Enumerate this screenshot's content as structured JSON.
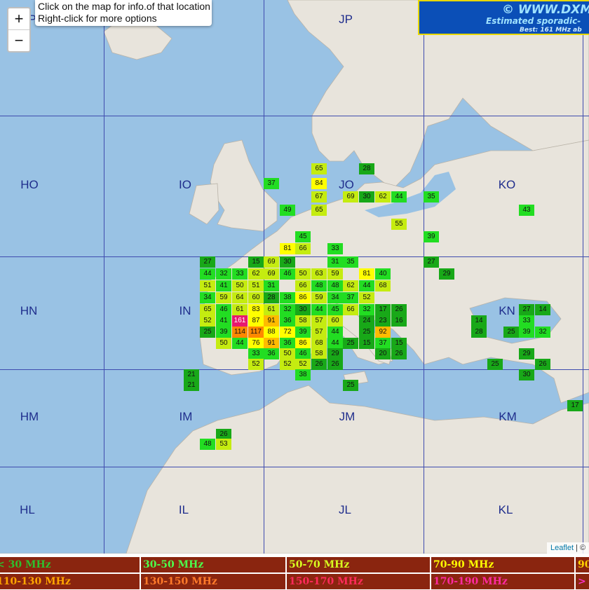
{
  "info_box": {
    "line1": "Click on the map for info.of that location",
    "line2": "Right-click for more options"
  },
  "zoom": {
    "in_label": "+",
    "out_label": "−"
  },
  "banner": {
    "line1": "© WWW.DXMA",
    "line2": "Estimated sporadic-",
    "line3": "Best: 161 MHz ab"
  },
  "attribution": {
    "link": "Leaflet",
    "rest": " | © "
  },
  "grid_labels": [
    "P",
    "JP",
    "HO",
    "IO",
    "JO",
    "KO",
    "HN",
    "IN",
    "JN",
    "KN",
    "HM",
    "IM",
    "JM",
    "KM",
    "HL",
    "IL",
    "JL",
    "KL"
  ],
  "cells": [
    {
      "v": "65",
      "c": "#c5ec10"
    },
    {
      "v": "28",
      "c": "#18a818"
    },
    {
      "v": "37",
      "c": "#22dd22"
    },
    {
      "v": "84",
      "c": "#ffff00"
    },
    {
      "v": "67",
      "c": "#c5ec10"
    },
    {
      "v": "69",
      "c": "#c5ec10"
    },
    {
      "v": "30",
      "c": "#18a818"
    },
    {
      "v": "62",
      "c": "#c5ec10"
    },
    {
      "v": "44",
      "c": "#22dd22"
    },
    {
      "v": "35",
      "c": "#22dd22"
    },
    {
      "v": "49",
      "c": "#22dd22"
    },
    {
      "v": "65",
      "c": "#c5ec10"
    },
    {
      "v": "43",
      "c": "#22dd22"
    },
    {
      "v": "55",
      "c": "#c5ec10"
    },
    {
      "v": "45",
      "c": "#22dd22"
    },
    {
      "v": "39",
      "c": "#22dd22"
    },
    {
      "v": "81",
      "c": "#ffff00"
    },
    {
      "v": "66",
      "c": "#c5ec10"
    },
    {
      "v": "33",
      "c": "#22dd22"
    },
    {
      "v": "27",
      "c": "#18a818"
    },
    {
      "v": "15",
      "c": "#18a818"
    },
    {
      "v": "69",
      "c": "#c5ec10"
    },
    {
      "v": "30",
      "c": "#18a818"
    },
    {
      "v": "31",
      "c": "#22dd22"
    },
    {
      "v": "35",
      "c": "#22dd22"
    },
    {
      "v": "27",
      "c": "#18a818"
    },
    {
      "v": "44",
      "c": "#22dd22"
    },
    {
      "v": "32",
      "c": "#22dd22"
    },
    {
      "v": "33",
      "c": "#22dd22"
    },
    {
      "v": "62",
      "c": "#c5ec10"
    },
    {
      "v": "69",
      "c": "#c5ec10"
    },
    {
      "v": "46",
      "c": "#22dd22"
    },
    {
      "v": "50",
      "c": "#c5ec10"
    },
    {
      "v": "63",
      "c": "#c5ec10"
    },
    {
      "v": "59",
      "c": "#c5ec10"
    },
    {
      "v": "81",
      "c": "#ffff00"
    },
    {
      "v": "40",
      "c": "#22dd22"
    },
    {
      "v": "29",
      "c": "#18a818"
    },
    {
      "v": "51",
      "c": "#c5ec10"
    },
    {
      "v": "41",
      "c": "#22dd22"
    },
    {
      "v": "50",
      "c": "#c5ec10"
    },
    {
      "v": "51",
      "c": "#c5ec10"
    },
    {
      "v": "31",
      "c": "#22dd22"
    },
    {
      "v": "66",
      "c": "#c5ec10"
    },
    {
      "v": "48",
      "c": "#22dd22"
    },
    {
      "v": "48",
      "c": "#22dd22"
    },
    {
      "v": "62",
      "c": "#c5ec10"
    },
    {
      "v": "44",
      "c": "#22dd22"
    },
    {
      "v": "68",
      "c": "#c5ec10"
    },
    {
      "v": "34",
      "c": "#22dd22"
    },
    {
      "v": "59",
      "c": "#c5ec10"
    },
    {
      "v": "64",
      "c": "#c5ec10"
    },
    {
      "v": "60",
      "c": "#c5ec10"
    },
    {
      "v": "28",
      "c": "#18a818"
    },
    {
      "v": "38",
      "c": "#22dd22"
    },
    {
      "v": "86",
      "c": "#ffff00"
    },
    {
      "v": "59",
      "c": "#c5ec10"
    },
    {
      "v": "34",
      "c": "#22dd22"
    },
    {
      "v": "37",
      "c": "#22dd22"
    },
    {
      "v": "52",
      "c": "#c5ec10"
    },
    {
      "v": "65",
      "c": "#c5ec10"
    },
    {
      "v": "46",
      "c": "#22dd22"
    },
    {
      "v": "61",
      "c": "#c5ec10"
    },
    {
      "v": "83",
      "c": "#ffff00"
    },
    {
      "v": "61",
      "c": "#c5ec10"
    },
    {
      "v": "32",
      "c": "#22dd22"
    },
    {
      "v": "30",
      "c": "#18a818"
    },
    {
      "v": "44",
      "c": "#22dd22"
    },
    {
      "v": "45",
      "c": "#22dd22"
    },
    {
      "v": "66",
      "c": "#c5ec10"
    },
    {
      "v": "32",
      "c": "#22dd22"
    },
    {
      "v": "17",
      "c": "#18a818"
    },
    {
      "v": "26",
      "c": "#18a818"
    },
    {
      "v": "27",
      "c": "#18a818"
    },
    {
      "v": "14",
      "c": "#18a818"
    },
    {
      "v": "52",
      "c": "#c5ec10"
    },
    {
      "v": "41",
      "c": "#22dd22"
    },
    {
      "v": "161",
      "c": "#e8186e"
    },
    {
      "v": "87",
      "c": "#ffff00"
    },
    {
      "v": "91",
      "c": "#ffbb00"
    },
    {
      "v": "36",
      "c": "#22dd22"
    },
    {
      "v": "58",
      "c": "#c5ec10"
    },
    {
      "v": "57",
      "c": "#c5ec10"
    },
    {
      "v": "60",
      "c": "#c5ec10"
    },
    {
      "v": "24",
      "c": "#18a818"
    },
    {
      "v": "23",
      "c": "#18a818"
    },
    {
      "v": "16",
      "c": "#18a818"
    },
    {
      "v": "14",
      "c": "#18a818"
    },
    {
      "v": "33",
      "c": "#22dd22"
    },
    {
      "v": "25",
      "c": "#18a818"
    },
    {
      "v": "39",
      "c": "#22dd22"
    },
    {
      "v": "114",
      "c": "#ff8800"
    },
    {
      "v": "117",
      "c": "#ff8800"
    },
    {
      "v": "88",
      "c": "#ffff00"
    },
    {
      "v": "72",
      "c": "#ffff00"
    },
    {
      "v": "39",
      "c": "#22dd22"
    },
    {
      "v": "57",
      "c": "#c5ec10"
    },
    {
      "v": "44",
      "c": "#22dd22"
    },
    {
      "v": "25",
      "c": "#18a818"
    },
    {
      "v": "92",
      "c": "#ffbb00"
    },
    {
      "v": "28",
      "c": "#18a818"
    },
    {
      "v": "25",
      "c": "#18a818"
    },
    {
      "v": "39",
      "c": "#22dd22"
    },
    {
      "v": "32",
      "c": "#22dd22"
    },
    {
      "v": "50",
      "c": "#c5ec10"
    },
    {
      "v": "44",
      "c": "#22dd22"
    },
    {
      "v": "76",
      "c": "#ffff00"
    },
    {
      "v": "91",
      "c": "#ffbb00"
    },
    {
      "v": "36",
      "c": "#22dd22"
    },
    {
      "v": "86",
      "c": "#ffff00"
    },
    {
      "v": "68",
      "c": "#c5ec10"
    },
    {
      "v": "44",
      "c": "#22dd22"
    },
    {
      "v": "25",
      "c": "#18a818"
    },
    {
      "v": "15",
      "c": "#18a818"
    },
    {
      "v": "37",
      "c": "#22dd22"
    },
    {
      "v": "15",
      "c": "#18a818"
    },
    {
      "v": "33",
      "c": "#22dd22"
    },
    {
      "v": "36",
      "c": "#22dd22"
    },
    {
      "v": "50",
      "c": "#c5ec10"
    },
    {
      "v": "46",
      "c": "#22dd22"
    },
    {
      "v": "58",
      "c": "#c5ec10"
    },
    {
      "v": "29",
      "c": "#18a818"
    },
    {
      "v": "20",
      "c": "#18a818"
    },
    {
      "v": "26",
      "c": "#18a818"
    },
    {
      "v": "29",
      "c": "#18a818"
    },
    {
      "v": "52",
      "c": "#c5ec10"
    },
    {
      "v": "52",
      "c": "#c5ec10"
    },
    {
      "v": "52",
      "c": "#c5ec10"
    },
    {
      "v": "26",
      "c": "#18a818"
    },
    {
      "v": "26",
      "c": "#18a818"
    },
    {
      "v": "25",
      "c": "#18a818"
    },
    {
      "v": "26",
      "c": "#18a818"
    },
    {
      "v": "21",
      "c": "#18a818"
    },
    {
      "v": "38",
      "c": "#22dd22"
    },
    {
      "v": "30",
      "c": "#18a818"
    },
    {
      "v": "21",
      "c": "#18a818"
    },
    {
      "v": "25",
      "c": "#18a818"
    },
    {
      "v": "17",
      "c": "#18a818"
    },
    {
      "v": "26",
      "c": "#18a818"
    },
    {
      "v": "48",
      "c": "#22dd22"
    },
    {
      "v": "53",
      "c": "#c5ec10"
    }
  ],
  "legend": [
    {
      "label": "< 30 MHz",
      "color": "#2ec02e"
    },
    {
      "label": "30-50 MHz",
      "color": "#4cff4c"
    },
    {
      "label": "50-70 MHz",
      "color": "#d8ff20"
    },
    {
      "label": "70-90 MHz",
      "color": "#ffff00"
    },
    {
      "label": "90",
      "color": "#ffd400"
    },
    {
      "label": "110-130 MHz",
      "color": "#ffa500"
    },
    {
      "label": "130-150 MHz",
      "color": "#ff7a2a"
    },
    {
      "label": "150-170 MHz",
      "color": "#ff2a5a"
    },
    {
      "label": "170-190 MHz",
      "color": "#ff2aa0"
    },
    {
      "label": ">",
      "color": "#ff33cc"
    }
  ]
}
